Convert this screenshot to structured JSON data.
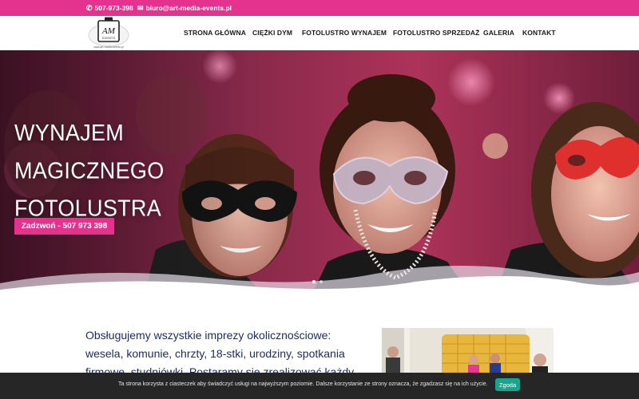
{
  "topbar": {
    "phone": "507-973-398",
    "email": "biuro@art-media-events.pl",
    "phone_icon": "phone-icon",
    "email_icon": "envelope-icon",
    "color": "#e3338f"
  },
  "logo": {
    "mark": "AM",
    "sub": "EVENTS",
    "url_text": "www.art-media-events.pl"
  },
  "nav": {
    "items": [
      "STRONA GŁÓWNA",
      "CIĘŻKI DYM",
      "FOTOLUSTRO WYNAJEM",
      "FOTOLUSTRO SPRZEDAŻ",
      "GALERIA",
      "KONTAKT"
    ]
  },
  "hero": {
    "title_lines": [
      "WYNAJEM",
      "MAGICZNEGO",
      "FOTOLUSTRA"
    ],
    "button_label": "Zadzwoń - 507 973 398",
    "slides": 2,
    "active_slide": 1
  },
  "content": {
    "text": "Obsługujemy wszystkie imprezy okolicznościowe: wesela, komunie, chrzty, 18-stki, urodziny, spotkania firmowe, studniówki. Postaramy się zrealizować każdy Twój pomysł!"
  },
  "cookie": {
    "message": "Ta strona korzysta z ciasteczek aby świadczyć usługi na najwyższym poziomie. Dalsze korzystanie ze strony oznacza, że zgadzasz się na ich użycie.",
    "accept_label": "Zgoda"
  },
  "colors": {
    "accent": "#e3338f",
    "heading_text": "#1c2b5a",
    "cookie_bg": "#262626",
    "cookie_button": "#19a58b"
  }
}
